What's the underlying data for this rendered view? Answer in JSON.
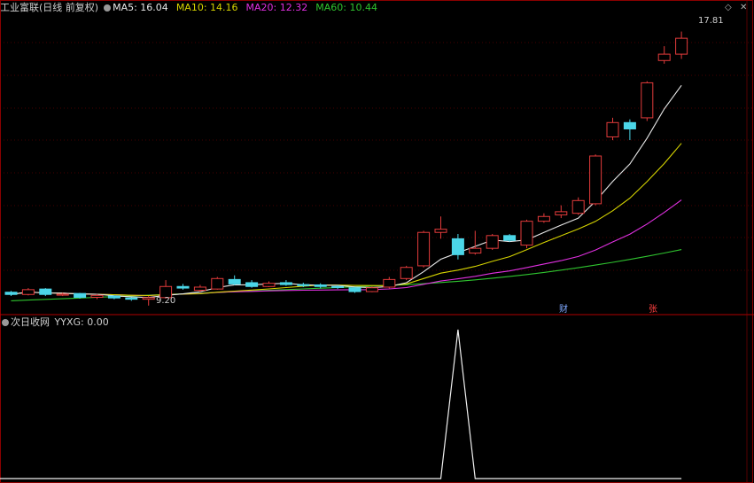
{
  "header": {
    "stock_title": "工业富联(日线 前复权)",
    "ma5_label": "MA5: 16.04",
    "ma10_label": "MA10: 14.16",
    "ma20_label": "MA20: 12.32",
    "ma60_label": "MA60: 10.44"
  },
  "lower_header": {
    "title": "次日收网",
    "value_label": "YYXG: 0.00"
  },
  "annotations": {
    "high_label": "17.81",
    "low_label": "9.20",
    "marker_cai": "财",
    "marker_zhang": "张"
  },
  "controls": {
    "diamond_symbol": "◇",
    "close_symbol": "✕"
  },
  "colors": {
    "background": "#000000",
    "up": "#e33b3b",
    "down": "#4bd6e8",
    "ma5": "#e8e8e8",
    "ma10": "#d6d400",
    "ma20": "#e030e0",
    "ma60": "#2fc42f",
    "grid": "#8b0000"
  },
  "chart_data": [
    {
      "type": "candlestick",
      "title": "工业富联(日线 前复权)",
      "ylim": [
        9.0,
        18.3
      ],
      "candles": [
        {
          "o": 9.62,
          "c": 9.55,
          "h": 9.66,
          "l": 9.5
        },
        {
          "o": 9.55,
          "c": 9.7,
          "h": 9.75,
          "l": 9.52
        },
        {
          "o": 9.72,
          "c": 9.55,
          "h": 9.75,
          "l": 9.5
        },
        {
          "o": 9.55,
          "c": 9.56,
          "h": 9.6,
          "l": 9.5
        },
        {
          "o": 9.58,
          "c": 9.46,
          "h": 9.6,
          "l": 9.42
        },
        {
          "o": 9.46,
          "c": 9.52,
          "h": 9.56,
          "l": 9.4
        },
        {
          "o": 9.5,
          "c": 9.44,
          "h": 9.52,
          "l": 9.4
        },
        {
          "o": 9.44,
          "c": 9.4,
          "h": 9.46,
          "l": 9.35
        },
        {
          "o": 9.4,
          "c": 9.45,
          "h": 9.5,
          "l": 9.2
        },
        {
          "o": 9.45,
          "c": 9.8,
          "h": 10.0,
          "l": 9.42
        },
        {
          "o": 9.8,
          "c": 9.75,
          "h": 9.88,
          "l": 9.7
        },
        {
          "o": 9.68,
          "c": 9.78,
          "h": 9.85,
          "l": 9.62
        },
        {
          "o": 9.72,
          "c": 10.05,
          "h": 10.1,
          "l": 9.7
        },
        {
          "o": 10.02,
          "c": 9.88,
          "h": 10.15,
          "l": 9.84
        },
        {
          "o": 9.92,
          "c": 9.8,
          "h": 10.0,
          "l": 9.76
        },
        {
          "o": 9.8,
          "c": 9.9,
          "h": 9.96,
          "l": 9.78
        },
        {
          "o": 9.92,
          "c": 9.86,
          "h": 10.0,
          "l": 9.82
        },
        {
          "o": 9.86,
          "c": 9.84,
          "h": 9.92,
          "l": 9.78
        },
        {
          "o": 9.85,
          "c": 9.8,
          "h": 9.9,
          "l": 9.74
        },
        {
          "o": 9.8,
          "c": 9.78,
          "h": 9.84,
          "l": 9.72
        },
        {
          "o": 9.76,
          "c": 9.64,
          "h": 9.78,
          "l": 9.6
        },
        {
          "o": 9.64,
          "c": 9.76,
          "h": 9.8,
          "l": 9.62
        },
        {
          "o": 9.78,
          "c": 10.02,
          "h": 10.1,
          "l": 9.74
        },
        {
          "o": 10.05,
          "c": 10.4,
          "h": 10.45,
          "l": 10.0
        },
        {
          "o": 10.45,
          "c": 11.5,
          "h": 11.55,
          "l": 10.4
        },
        {
          "o": 11.5,
          "c": 11.6,
          "h": 12.0,
          "l": 11.3
        },
        {
          "o": 11.3,
          "c": 10.8,
          "h": 11.45,
          "l": 10.65
        },
        {
          "o": 10.85,
          "c": 11.0,
          "h": 11.55,
          "l": 10.8
        },
        {
          "o": 11.0,
          "c": 11.4,
          "h": 11.45,
          "l": 10.95
        },
        {
          "o": 11.4,
          "c": 11.25,
          "h": 11.45,
          "l": 11.2
        },
        {
          "o": 11.1,
          "c": 11.85,
          "h": 11.9,
          "l": 11.0
        },
        {
          "o": 11.85,
          "c": 12.0,
          "h": 12.1,
          "l": 11.8
        },
        {
          "o": 12.05,
          "c": 12.15,
          "h": 12.35,
          "l": 11.95
        },
        {
          "o": 12.1,
          "c": 12.5,
          "h": 12.6,
          "l": 12.05
        },
        {
          "o": 12.4,
          "c": 13.9,
          "h": 13.95,
          "l": 12.35
        },
        {
          "o": 14.5,
          "c": 14.95,
          "h": 15.1,
          "l": 14.4
        },
        {
          "o": 14.95,
          "c": 14.75,
          "h": 15.05,
          "l": 14.4
        },
        {
          "o": 15.1,
          "c": 16.2,
          "h": 16.25,
          "l": 15.0
        },
        {
          "o": 16.9,
          "c": 17.1,
          "h": 17.35,
          "l": 16.8
        },
        {
          "o": 17.1,
          "c": 17.6,
          "h": 17.81,
          "l": 16.95
        }
      ]
    },
    {
      "type": "line",
      "title": "次日收网",
      "series_name": "YYXG",
      "ylim": [
        0,
        1
      ],
      "values": [
        0,
        0,
        0,
        0,
        0,
        0,
        0,
        0,
        0,
        0,
        0,
        0,
        0,
        0,
        0,
        0,
        0,
        0,
        0,
        0,
        0,
        0,
        0,
        0,
        0,
        0,
        1,
        0,
        0,
        0,
        0,
        0,
        0,
        0,
        0,
        0,
        0,
        0,
        0,
        0
      ]
    }
  ]
}
